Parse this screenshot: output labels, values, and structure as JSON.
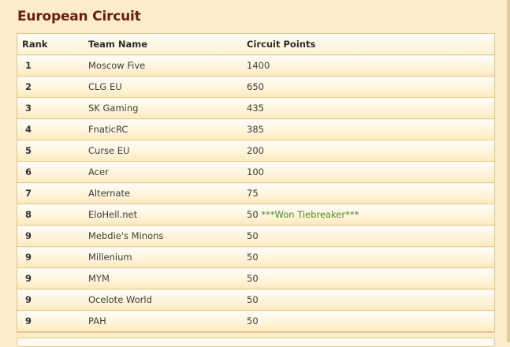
{
  "page": {
    "title": "European Circuit"
  },
  "table": {
    "headers": [
      "Rank",
      "Team Name",
      "Circuit Points"
    ],
    "rows": [
      {
        "rank": "1",
        "team": "Moscow Five",
        "points": "1400",
        "note": ""
      },
      {
        "rank": "2",
        "team": "CLG EU",
        "points": "650",
        "note": ""
      },
      {
        "rank": "3",
        "team": "SK Gaming",
        "points": "435",
        "note": ""
      },
      {
        "rank": "4",
        "team": "FnaticRC",
        "points": "385",
        "note": ""
      },
      {
        "rank": "5",
        "team": "Curse EU",
        "points": "200",
        "note": ""
      },
      {
        "rank": "6",
        "team": "Acer",
        "points": "100",
        "note": ""
      },
      {
        "rank": "7",
        "team": "Alternate",
        "points": "75",
        "note": ""
      },
      {
        "rank": "8",
        "team": "EloHell.net",
        "points": "50",
        "note": "***Won Tiebreaker***"
      },
      {
        "rank": "9",
        "team": "Mebdie's Minons",
        "points": "50",
        "note": ""
      },
      {
        "rank": "9",
        "team": "Millenium",
        "points": "50",
        "note": ""
      },
      {
        "rank": "9",
        "team": "MYM",
        "points": "50",
        "note": ""
      },
      {
        "rank": "9",
        "team": "Ocelote World",
        "points": "50",
        "note": ""
      },
      {
        "rank": "9",
        "team": "PAH",
        "points": "50",
        "note": ""
      }
    ]
  },
  "colors": {
    "title": "#6b1d12",
    "background": "#fbeccb",
    "border": "#dfc58b",
    "note": "#4c8a2a"
  }
}
